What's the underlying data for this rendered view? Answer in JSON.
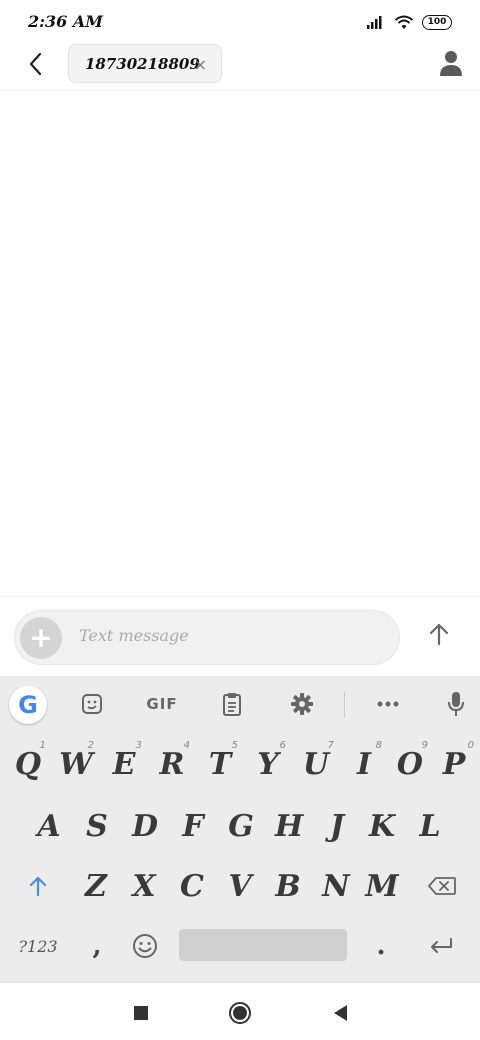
{
  "status_bar": {
    "time": "2:36 AM",
    "battery": "100",
    "icons": [
      "signal-icon",
      "wifi-icon",
      "battery-icon"
    ]
  },
  "header": {
    "back_icon": "chevron-left-icon",
    "recipient": "18730218809",
    "chip_close": "×",
    "contact_icon": "person-icon"
  },
  "compose": {
    "add_label": "+",
    "placeholder": "Text message",
    "send_icon": "arrow-up-icon"
  },
  "keyboard": {
    "toolbar": {
      "google": "G",
      "sticker_icon": "sticker-icon",
      "gif": "GIF",
      "clipboard_icon": "clipboard-icon",
      "settings_icon": "gear-icon",
      "more_icon": "more-horizontal-icon",
      "mic_icon": "microphone-icon"
    },
    "row1": [
      "Q",
      "W",
      "E",
      "R",
      "T",
      "Y",
      "U",
      "I",
      "O",
      "P"
    ],
    "row1_hints": [
      "1",
      "2",
      "3",
      "4",
      "5",
      "6",
      "7",
      "8",
      "9",
      "0"
    ],
    "row2": [
      "A",
      "S",
      "D",
      "F",
      "G",
      "H",
      "J",
      "K",
      "L"
    ],
    "row3": [
      "Z",
      "X",
      "C",
      "V",
      "B",
      "N",
      "M"
    ],
    "bottom": {
      "symbols": "?123",
      "comma": ",",
      "emoji_icon": "emoji-icon",
      "period": ".",
      "enter_icon": "enter-icon"
    }
  },
  "nav": {
    "recents_icon": "square-icon",
    "home_icon": "circle-icon",
    "back_icon": "triangle-back-icon"
  },
  "colors": {
    "accent": "#4a90d9",
    "keyboard_bg": "#ececec",
    "key_text": "#3a3a3a"
  }
}
